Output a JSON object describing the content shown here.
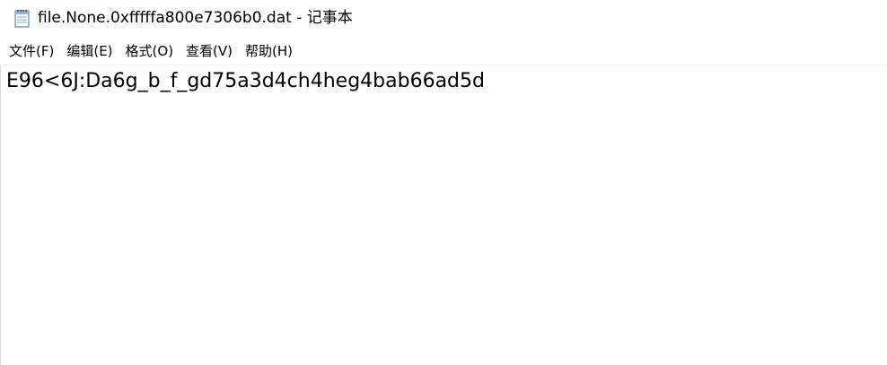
{
  "window": {
    "title": "file.None.0xfffffa800e7306b0.dat - 记事本",
    "icon": "notepad-icon"
  },
  "menu": [
    {
      "label": "文件(F)"
    },
    {
      "label": "编辑(E)"
    },
    {
      "label": "格式(O)"
    },
    {
      "label": "查看(V)"
    },
    {
      "label": "帮助(H)"
    }
  ],
  "editor": {
    "content": "E96<6J:Da6g_b_f_gd75a3d4ch4heg4bab66ad5d"
  }
}
